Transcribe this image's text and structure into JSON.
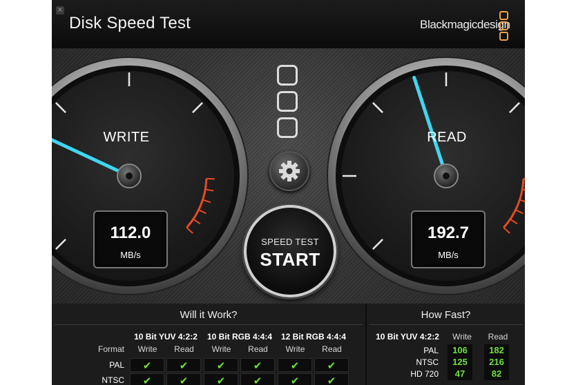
{
  "window": {
    "title": "Disk Speed Test",
    "brand": "Blackmagicdesign",
    "close_glyph": "×",
    "accent": "#f0a24a"
  },
  "write_gauge": {
    "label": "WRITE",
    "value": "112.0",
    "unit": "MB/s",
    "needle_color": "#3fd6f2"
  },
  "read_gauge": {
    "label": "READ",
    "value": "192.7",
    "unit": "MB/s",
    "needle_color": "#3fd6f2"
  },
  "controls": {
    "settings_icon": "gear-icon",
    "start_small": "SPEED TEST",
    "start_big": "START"
  },
  "will_it_work": {
    "title": "Will it Work?",
    "format_label": "Format",
    "codecs": [
      {
        "name": "10 Bit YUV 4:2:2",
        "write": "Write",
        "read": "Read"
      },
      {
        "name": "10 Bit RGB 4:4:4",
        "write": "Write",
        "read": "Read"
      },
      {
        "name": "12 Bit RGB 4:4:4",
        "write": "Write",
        "read": "Read"
      }
    ],
    "rows": [
      {
        "format": "PAL",
        "checks": [
          "✔",
          "✔",
          "✔",
          "✔",
          "✔",
          "✔"
        ]
      },
      {
        "format": "NTSC",
        "checks": [
          "✔",
          "✔",
          "✔",
          "✔",
          "✔",
          "✔"
        ]
      }
    ]
  },
  "how_fast": {
    "title": "How Fast?",
    "codec": "10 Bit YUV 4:2:2",
    "write_label": "Write",
    "read_label": "Read",
    "rows": [
      {
        "format": "PAL",
        "write": "106",
        "read": "182"
      },
      {
        "format": "NTSC",
        "write": "125",
        "read": "216"
      },
      {
        "format": "HD 720",
        "write": "47",
        "read": "82"
      }
    ]
  }
}
